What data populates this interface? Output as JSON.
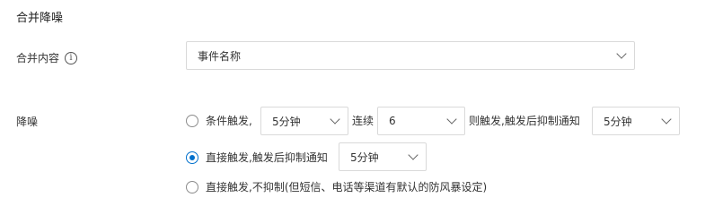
{
  "section": {
    "title": "合并降噪"
  },
  "merge_content": {
    "label": "合并内容",
    "info_icon": "i",
    "select_value": "事件名称"
  },
  "noise": {
    "label": "降噪",
    "option1": {
      "label": "条件触发,",
      "period_value": "5分钟",
      "consecutive_label": "连续",
      "count_value": "6",
      "then_label": "则触发,触发后抑制通知",
      "suppress_value": "5分钟",
      "selected": false
    },
    "option2": {
      "label": "直接触发,触发后抑制通知",
      "suppress_value": "5分钟",
      "selected": true
    },
    "option3": {
      "label": "直接触发,不抑制(但短信、电话等渠道有默认的防风暴设定)",
      "selected": false
    }
  },
  "colors": {
    "accent": "#0070cc",
    "border": "#d9d9d9",
    "text": "#333333"
  }
}
